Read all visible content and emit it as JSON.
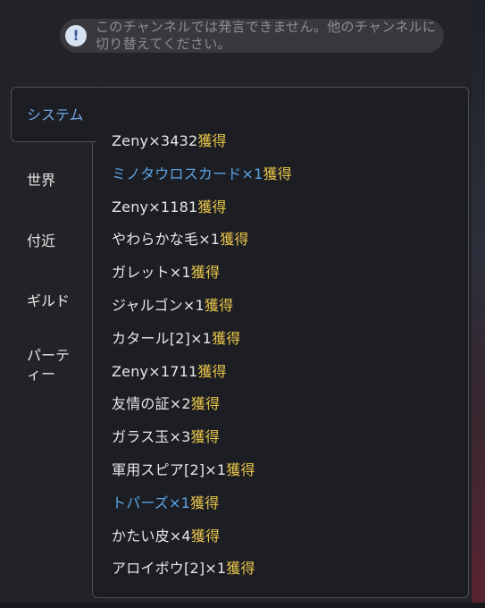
{
  "notice": {
    "icon": "info-icon",
    "icon_glyph": "!",
    "text": "このチャンネルでは発言できません。他のチャンネルに切り替えてください。"
  },
  "tabs": {
    "active": "システム",
    "others": [
      "世界",
      "付近",
      "ギルド",
      "パーティー"
    ]
  },
  "colors": {
    "active_tab": "#74a8e6",
    "highlight_item": "#5da3e5",
    "acquired_suffix": "#e9c54a",
    "text": "#e6e6e6"
  },
  "messages": [
    {
      "item": "Zeny×3432",
      "suffix": "獲得",
      "highlight": false
    },
    {
      "item": "ミノタウロスカード×1",
      "suffix": "獲得",
      "highlight": true
    },
    {
      "item": "Zeny×1181",
      "suffix": "獲得",
      "highlight": false
    },
    {
      "item": "やわらかな毛×1",
      "suffix": "獲得",
      "highlight": false
    },
    {
      "item": "ガレット×1",
      "suffix": "獲得",
      "highlight": false
    },
    {
      "item": "ジャルゴン×1",
      "suffix": "獲得",
      "highlight": false
    },
    {
      "item": "カタール[2]×1",
      "suffix": "獲得",
      "highlight": false
    },
    {
      "item": "Zeny×1711",
      "suffix": "獲得",
      "highlight": false
    },
    {
      "item": "友情の証×2",
      "suffix": "獲得",
      "highlight": false
    },
    {
      "item": "ガラス玉×3",
      "suffix": "獲得",
      "highlight": false
    },
    {
      "item": "軍用スピア[2]×1",
      "suffix": "獲得",
      "highlight": false
    },
    {
      "item": "トパーズ×1",
      "suffix": "獲得",
      "highlight": true
    },
    {
      "item": "かたい皮×4",
      "suffix": "獲得",
      "highlight": false
    },
    {
      "item": "アロイボウ[2]×1",
      "suffix": "獲得",
      "highlight": false
    }
  ]
}
